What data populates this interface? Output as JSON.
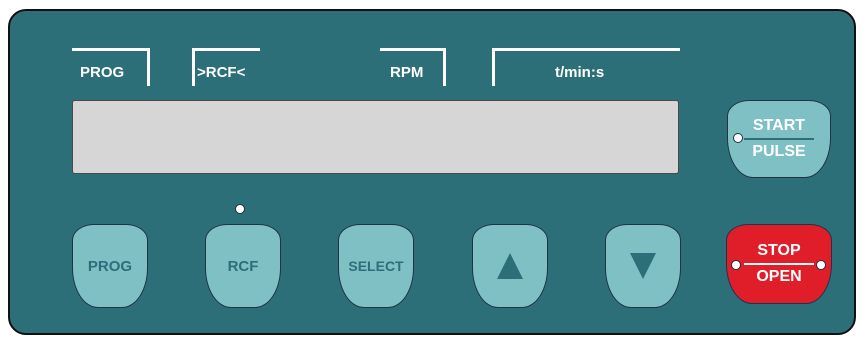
{
  "header": {
    "prog": "PROG",
    "rcf": ">RCF<",
    "rpm": "RPM",
    "time": "t/min:s"
  },
  "buttons": {
    "start_top": "START",
    "start_bottom": "PULSE",
    "prog": "PROG",
    "rcf": "RCF",
    "select": "SELECT",
    "stop_top": "STOP",
    "stop_bottom": "OPEN"
  },
  "colors": {
    "panel": "#2d6f79",
    "button": "#7fc0c5",
    "stop_button": "#e01e2a",
    "display": "#d6d6d6"
  },
  "icons": {
    "up": "up-triangle",
    "down": "down-triangle"
  }
}
